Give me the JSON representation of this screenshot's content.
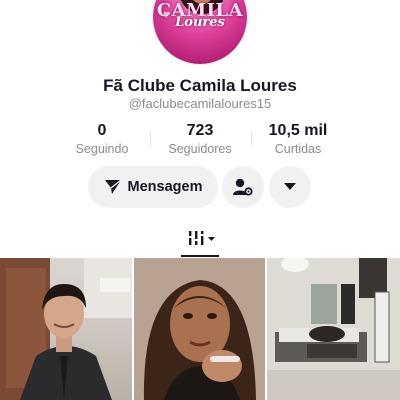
{
  "profile": {
    "avatar_text_line1": "CAMILA",
    "avatar_text_line2": "Loures",
    "name": "Fã Clube Camila Loures",
    "handle": "@faclubecamilaloures15"
  },
  "stats": [
    {
      "value": "0",
      "label": "Seguindo"
    },
    {
      "value": "723",
      "label": "Seguidores"
    },
    {
      "value": "10,5 mil",
      "label": "Curtidas"
    }
  ],
  "actions": {
    "message_label": "Mensagem",
    "message_icon": "paper-plane-icon",
    "user_icon": "user-settings-icon",
    "more_icon": "caret-down-icon"
  },
  "tabs": {
    "active_icon": "grid-filter-icon"
  },
  "videos": [
    {
      "name": "video-thumbnail-1"
    },
    {
      "name": "video-thumbnail-2"
    },
    {
      "name": "video-thumbnail-3"
    }
  ]
}
